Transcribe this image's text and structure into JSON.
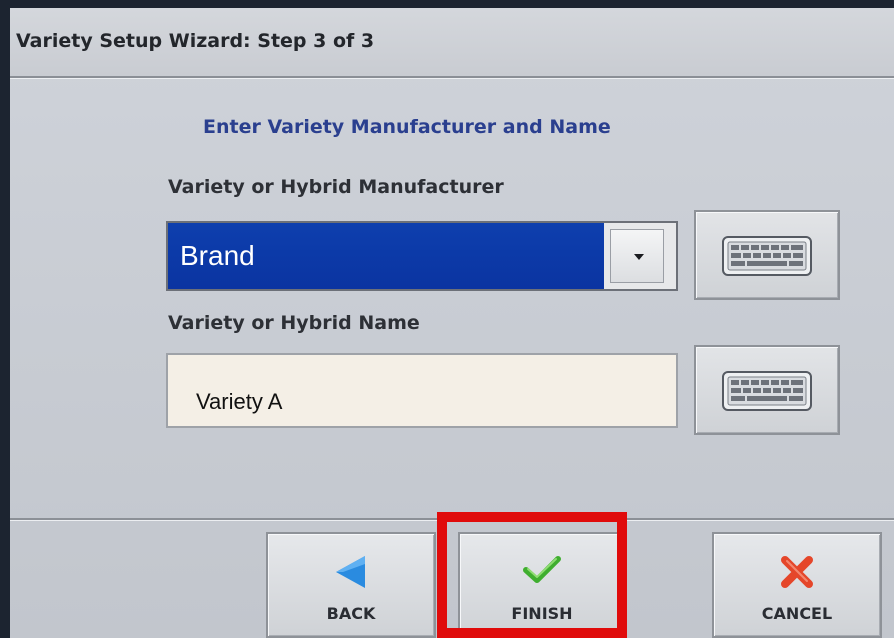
{
  "window": {
    "title": "Variety Setup Wizard:  Step 3 of 3"
  },
  "heading": "Enter Variety Manufacturer and Name",
  "manufacturer": {
    "label": "Variety or Hybrid Manufacturer",
    "selected_value": "Brand",
    "dropdown_icon": "chevron-down-icon",
    "keyboard_icon": "keyboard-icon"
  },
  "name": {
    "label": "Variety or Hybrid Name",
    "value": "Variety A",
    "keyboard_icon": "keyboard-icon"
  },
  "actions": {
    "back_label": "BACK",
    "finish_label": "FINISH",
    "cancel_label": "CANCEL"
  },
  "colors": {
    "selection_bg": "#0a34a1",
    "heading_text": "#2a3f8f",
    "highlight_border": "#e00b0b",
    "back_icon": "#2a8be0",
    "finish_icon": "#3fae2f",
    "cancel_icon": "#e5462a"
  }
}
